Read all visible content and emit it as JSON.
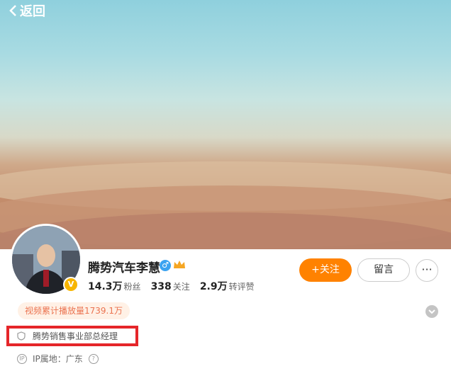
{
  "nav": {
    "back_label": "返回"
  },
  "profile": {
    "name": "腾势汽车李慧",
    "gender_symbol": "♂",
    "verified_symbol": "V",
    "stats": [
      {
        "value": "14.3万",
        "label": "粉丝"
      },
      {
        "value": "338",
        "label": "关注"
      },
      {
        "value": "2.9万",
        "label": "转评赞"
      }
    ],
    "video_plays": "视频累计播放量1739.1万",
    "job_title": "腾势销售事业部总经理",
    "ip_location": "IP属地：广东"
  },
  "actions": {
    "follow_label": "+关注",
    "message_label": "留言",
    "more_label": "···"
  },
  "colors": {
    "accent": "#ff8200",
    "highlight_box": "#e5262a",
    "badge": "#f7b500",
    "gender": "#3ba3f0"
  }
}
